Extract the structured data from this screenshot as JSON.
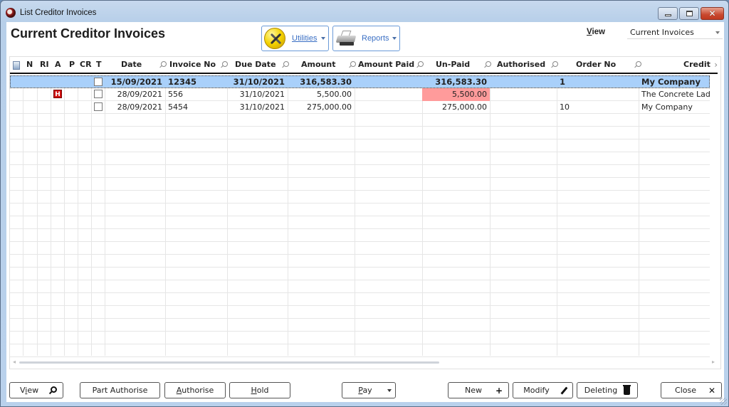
{
  "window": {
    "title": "List Creditor Invoices",
    "controls": {
      "minimize": "minimize",
      "maximize": "maximize",
      "close": "close"
    }
  },
  "header": {
    "page_title": "Current Creditor Invoices",
    "utilities_label": "Utilities",
    "reports_label": "Reports",
    "view_label": "View",
    "view_selected": "Current Invoices"
  },
  "grid": {
    "columns": [
      {
        "key": "icon",
        "label": ""
      },
      {
        "key": "n",
        "label": "N"
      },
      {
        "key": "ri",
        "label": "RI"
      },
      {
        "key": "a",
        "label": "A"
      },
      {
        "key": "p",
        "label": "P"
      },
      {
        "key": "cr",
        "label": "CR"
      },
      {
        "key": "t",
        "label": "T"
      },
      {
        "key": "date",
        "label": "Date"
      },
      {
        "key": "invoice_no",
        "label": "Invoice No"
      },
      {
        "key": "due_date",
        "label": "Due Date"
      },
      {
        "key": "amount",
        "label": "Amount"
      },
      {
        "key": "amount_paid",
        "label": "Amount Paid"
      },
      {
        "key": "unpaid",
        "label": "Un-Paid"
      },
      {
        "key": "authorised",
        "label": "Authorised"
      },
      {
        "key": "order_no",
        "label": "Order No"
      },
      {
        "key": "creditor",
        "label": "Credit"
      }
    ],
    "rows": [
      {
        "selected": true,
        "hold": false,
        "date": "15/09/2021",
        "invoice_no": "12345",
        "due_date": "31/10/2021",
        "amount": "316,583.30",
        "amount_paid": "",
        "unpaid": "316,583.30",
        "unpaid_alert": false,
        "authorised": "",
        "order_no": "1",
        "creditor": "My Company"
      },
      {
        "selected": false,
        "hold": true,
        "hold_label": "H",
        "date": "28/09/2021",
        "invoice_no": "556",
        "due_date": "31/10/2021",
        "amount": "5,500.00",
        "amount_paid": "",
        "unpaid": "5,500.00",
        "unpaid_alert": true,
        "authorised": "",
        "order_no": "",
        "creditor": "The Concrete Lad"
      },
      {
        "selected": false,
        "hold": false,
        "date": "28/09/2021",
        "invoice_no": "5454",
        "due_date": "31/10/2021",
        "amount": "275,000.00",
        "amount_paid": "",
        "unpaid": "275,000.00",
        "unpaid_alert": false,
        "authorised": "",
        "order_no": "10",
        "creditor": "My Company"
      }
    ],
    "colors": {
      "selected_row": "#a9d0fa",
      "unpaid_alert": "#ff9b9b",
      "hold_badge": "#d01010"
    }
  },
  "footer": {
    "view_label": "View",
    "part_authorise_label": "Part Authorise",
    "authorise_label": "Authorise",
    "hold_label": "Hold",
    "pay_label": "Pay",
    "new_label": "New",
    "modify_label": "Modify",
    "deleting_label": "Deleting",
    "close_label": "Close"
  }
}
